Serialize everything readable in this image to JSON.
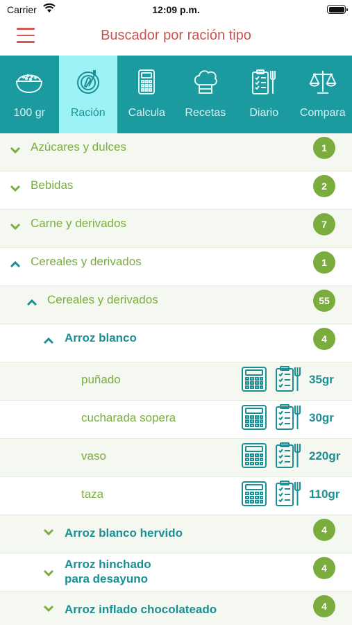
{
  "status_bar": {
    "carrier": "Carrier",
    "time": "12:09 p.m."
  },
  "header": {
    "title": "Buscador por ración tipo"
  },
  "colors": {
    "accent_teal": "#1b9aa0",
    "active_tab": "#9cf2f5",
    "green": "#7aad3e",
    "title_red": "#c75450"
  },
  "tabs": [
    {
      "label": "100 gr",
      "icon": "bowl-icon",
      "active": false
    },
    {
      "label": "Ración",
      "icon": "plate-fork-icon",
      "active": true
    },
    {
      "label": "Calcula",
      "icon": "calculator-icon",
      "active": false
    },
    {
      "label": "Recetas",
      "icon": "chef-hat-icon",
      "active": false
    },
    {
      "label": "Diario",
      "icon": "clipboard-fork-icon",
      "active": false
    },
    {
      "label": "Compara",
      "icon": "scale-icon",
      "active": false
    }
  ],
  "list": {
    "categories": [
      {
        "label": "Azúcares y dulces",
        "count": "1",
        "expanded": false
      },
      {
        "label": "Bebidas",
        "count": "2",
        "expanded": false
      },
      {
        "label": "Carne y derivados",
        "count": "7",
        "expanded": false
      },
      {
        "label": "Cereales y derivados",
        "count": "1",
        "expanded": true
      }
    ],
    "subcategory": {
      "label": "Cereales y derivados",
      "count": "55",
      "expanded": true
    },
    "food": {
      "label": "Arroz blanco",
      "count": "4",
      "expanded": true
    },
    "servings": [
      {
        "label": "puñado",
        "grams": "35gr"
      },
      {
        "label": "cucharada sopera",
        "grams": "30gr"
      },
      {
        "label": "vaso",
        "grams": "220gr"
      },
      {
        "label": "taza",
        "grams": "110gr"
      }
    ],
    "other_foods": [
      {
        "label": "Arroz blanco hervido",
        "count": "4"
      },
      {
        "label_line1": "Arroz hinchado",
        "label_line2": "para desayuno",
        "count": "4"
      },
      {
        "label": "Arroz inflado chocolateado",
        "count": "4"
      }
    ]
  }
}
